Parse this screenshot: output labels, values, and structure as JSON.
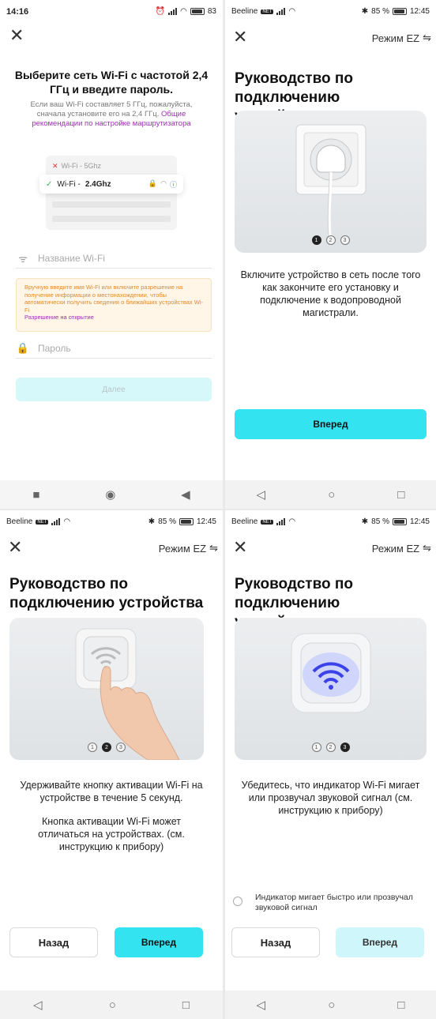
{
  "screen1": {
    "status": {
      "time": "14:16",
      "battery": "83"
    },
    "title": "Выберите сеть Wi-Fi с частотой 2,4 ГГц и введите пароль.",
    "subtitle": "Если ваш Wi-Fi составляет 5 ГГц, пожалуйста, сначала установите его на 2,4 ГГц.",
    "subtitle_link": "Общие рекомендации по настройке маршрутизатора",
    "wifi_5_label": "Wi-Fi - 5Ghz",
    "wifi_24_prefix": "Wi-Fi -",
    "wifi_24_band": "2.4Ghz",
    "wifi_name_placeholder": "Название Wi-Fi",
    "warning_text": "Вручную введите имя Wi-Fi или включите разрешение на получение информации о местонахождении, чтобы автоматически получить сведения о ближайших устройствах Wi-Fi",
    "warning_link": "Разрешение на открытие",
    "password_placeholder": "Пароль",
    "next_label": "Далее"
  },
  "screen2": {
    "status": {
      "carrier": "Beeline",
      "badge": "NET",
      "battery": "85 %",
      "time": "12:45"
    },
    "mode_label": "Режим EZ",
    "title": "Руководство по подключению устройства",
    "steps": [
      "1",
      "2",
      "3"
    ],
    "active_step": 1,
    "description": "Включите устройство в сеть после того как закончите его установку и подключение к водопроводной магистрали.",
    "next_label": "Вперед"
  },
  "screen3": {
    "status": {
      "carrier": "Beeline",
      "badge": "NET",
      "battery": "85 %",
      "time": "12:45"
    },
    "mode_label": "Режим EZ",
    "title": "Руководство по подключению устройства",
    "steps": [
      "1",
      "2",
      "3"
    ],
    "active_step": 2,
    "description1": "Удерживайте кнопку активации Wi-Fi на устройстве в течение 5 секунд.",
    "description2": "Кнопка активации Wi-Fi может отличаться на устройствах. (см. инструкцию к прибору)",
    "back_label": "Назад",
    "next_label": "Вперед"
  },
  "screen4": {
    "status": {
      "carrier": "Beeline",
      "badge": "NET",
      "battery": "85 %",
      "time": "12:45"
    },
    "mode_label": "Режим EZ",
    "title": "Руководство по подключению устройства",
    "steps": [
      "1",
      "2",
      "3"
    ],
    "active_step": 3,
    "description": "Убедитесь, что индикатор Wi-Fi мигает или прозвучал звуковой сигнал (см. инструкцию к прибору)",
    "confirm_label": "Индикатор мигает быстро или прозвучал звуковой сигнал",
    "back_label": "Назад",
    "next_label": "Вперед"
  },
  "colors": {
    "accent": "#34e3f0",
    "accent_light": "#cff7fb",
    "link": "#9b2fae",
    "warning": "#e08a2c"
  }
}
